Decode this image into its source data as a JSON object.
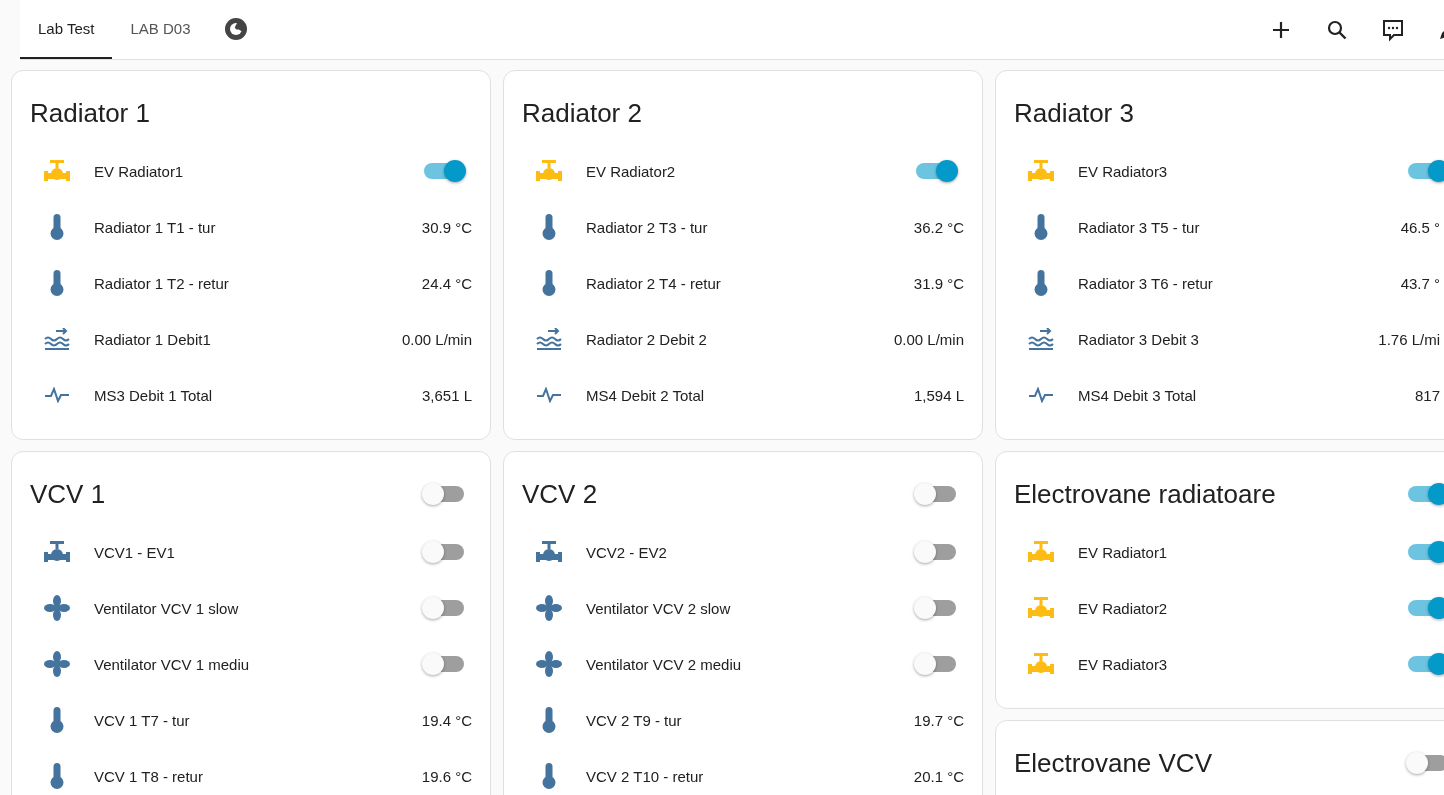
{
  "tabs": [
    {
      "label": "Lab Test",
      "selected": true
    },
    {
      "label": "LAB D03",
      "selected": false
    }
  ],
  "columns": [
    [
      {
        "title": "Radiator 1",
        "rows": [
          {
            "kind": "valve",
            "name": "EV Radiator1",
            "on": true
          },
          {
            "kind": "temperature",
            "name": "Radiator 1 T1 - tur",
            "value": "30.9 °C"
          },
          {
            "kind": "temperature",
            "name": "Radiator 1 T2 - retur",
            "value": "24.4 °C"
          },
          {
            "kind": "flow",
            "name": "Radiator 1 Debit1",
            "value": "0.00 L/min"
          },
          {
            "kind": "meter",
            "name": "MS3 Debit 1 Total",
            "value": "3,651 L"
          }
        ]
      },
      {
        "title": "VCV 1",
        "on": false,
        "rows": [
          {
            "kind": "valve",
            "name": "VCV1 - EV1",
            "on": false
          },
          {
            "kind": "fan",
            "name": "Ventilator VCV 1 slow",
            "on": false
          },
          {
            "kind": "fan",
            "name": "Ventilator VCV 1 mediu",
            "on": false
          },
          {
            "kind": "temperature",
            "name": "VCV 1 T7 - tur",
            "value": "19.4 °C"
          },
          {
            "kind": "temperature",
            "name": "VCV 1 T8 - retur",
            "value": "19.6 °C"
          }
        ]
      }
    ],
    [
      {
        "title": "Radiator 2",
        "rows": [
          {
            "kind": "valve",
            "name": "EV Radiator2",
            "on": true
          },
          {
            "kind": "temperature",
            "name": "Radiator 2 T3 - tur",
            "value": "36.2 °C"
          },
          {
            "kind": "temperature",
            "name": "Radiator 2 T4 - retur",
            "value": "31.9 °C"
          },
          {
            "kind": "flow",
            "name": "Radiator 2 Debit 2",
            "value": "0.00 L/min"
          },
          {
            "kind": "meter",
            "name": "MS4 Debit 2 Total",
            "value": "1,594 L"
          }
        ]
      },
      {
        "title": "VCV 2",
        "on": false,
        "rows": [
          {
            "kind": "valve",
            "name": "VCV2 - EV2",
            "on": false
          },
          {
            "kind": "fan",
            "name": "Ventilator VCV 2 slow",
            "on": false
          },
          {
            "kind": "fan",
            "name": "Ventilator VCV 2 mediu",
            "on": false
          },
          {
            "kind": "temperature",
            "name": "VCV 2 T9 - tur",
            "value": "19.7 °C"
          },
          {
            "kind": "temperature",
            "name": "VCV 2 T10 - retur",
            "value": "20.1 °C"
          }
        ]
      }
    ],
    [
      {
        "title": "Radiator 3",
        "rows": [
          {
            "kind": "valve",
            "name": "EV Radiator3",
            "on": true
          },
          {
            "kind": "temperature",
            "name": "Radiator 3 T5 - tur",
            "value": "46.5 °"
          },
          {
            "kind": "temperature",
            "name": "Radiator 3 T6 - retur",
            "value": "43.7 °"
          },
          {
            "kind": "flow",
            "name": "Radiator 3 Debit 3",
            "value": "1.76 L/mi"
          },
          {
            "kind": "meter",
            "name": "MS4 Debit 3 Total",
            "value": "817"
          }
        ]
      },
      {
        "title": "Electrovane radiatoare",
        "on": true,
        "rows": [
          {
            "kind": "valve",
            "name": "EV Radiator1",
            "on": true
          },
          {
            "kind": "valve",
            "name": "EV Radiator2",
            "on": true
          },
          {
            "kind": "valve",
            "name": "EV Radiator3",
            "on": true
          }
        ]
      },
      {
        "title": "Electrovane VCV",
        "on": false
      }
    ]
  ]
}
